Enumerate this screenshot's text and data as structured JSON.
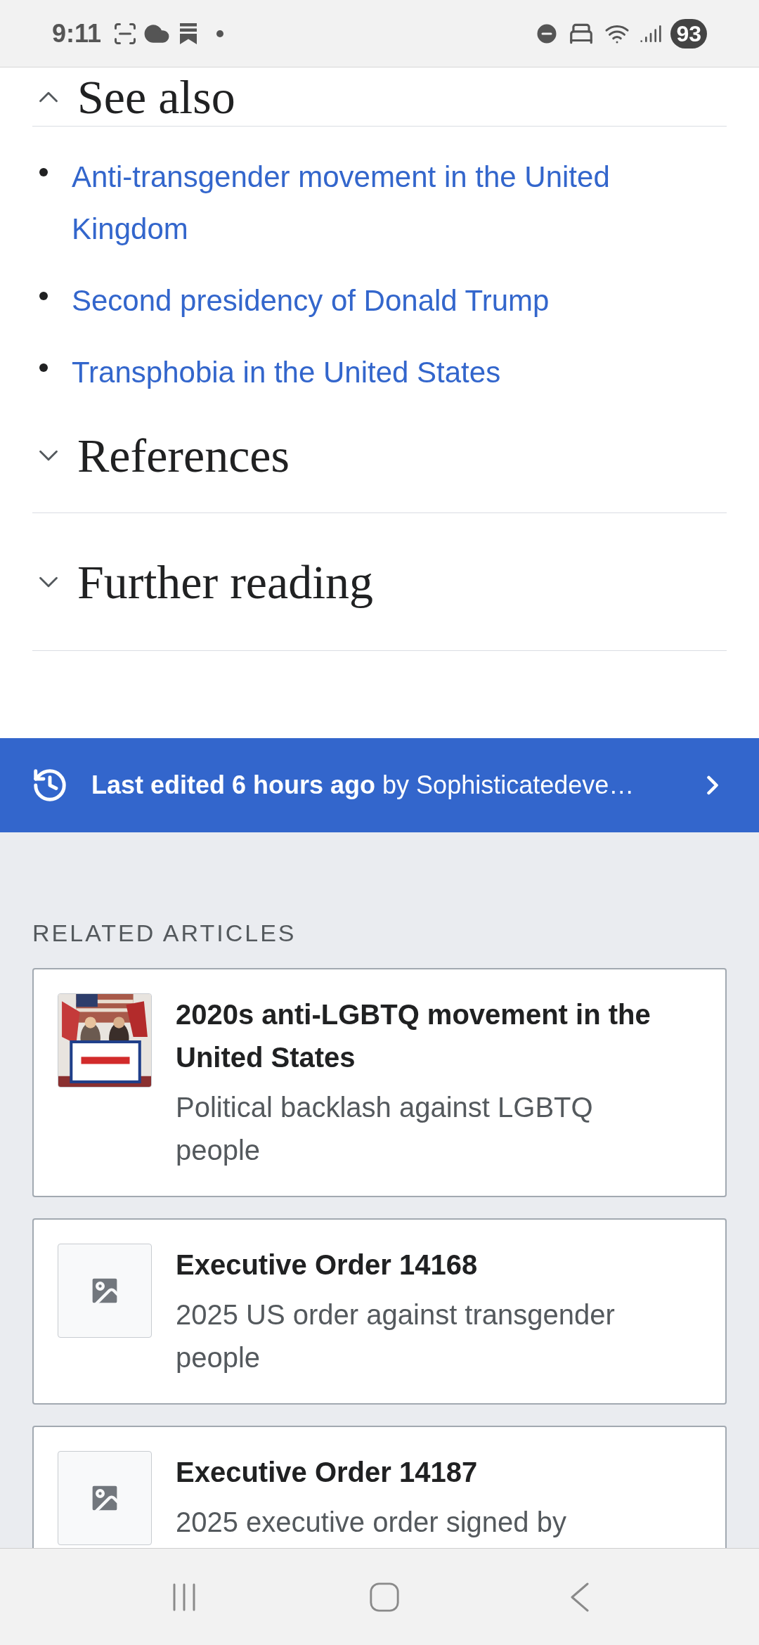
{
  "status_bar": {
    "time": "9:11",
    "battery": "93"
  },
  "sections": [
    {
      "title": "See also",
      "expanded": true,
      "links": [
        "Anti-transgender movement in the United Kingdom",
        "Second presidency of Donald Trump",
        "Transphobia in the United States"
      ]
    },
    {
      "title": "References",
      "expanded": false
    },
    {
      "title": "Further reading",
      "expanded": false
    }
  ],
  "last_edited": {
    "text": "**Last edited 6 hours ago** by Sophisticatedeve…"
  },
  "related": {
    "heading": "RELATED ARTICLES",
    "articles": [
      {
        "title": "2020s anti-LGBTQ movement in the United States",
        "description": "Political backlash against LGBTQ people"
      },
      {
        "title": "Executive Order 14168",
        "description": "2025 US order against transgender people",
        "thumbnail": {
          "kind": "placeholder"
        }
      },
      {
        "title": "Executive Order 14187",
        "description": "2025 executive order signed by",
        "thumbnail": {
          "kind": "placeholder"
        }
      }
    ]
  }
}
